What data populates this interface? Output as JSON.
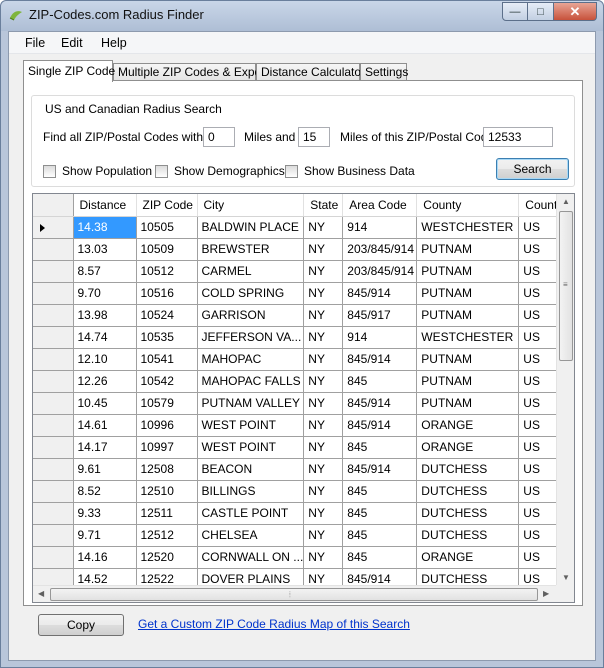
{
  "window": {
    "title": "ZIP-Codes.com Radius Finder",
    "icon": "zip-codes-logo",
    "controls": {
      "minimize": "—",
      "maximize": "□",
      "close": "✕"
    }
  },
  "menu": [
    "File",
    "Edit",
    "Help"
  ],
  "tabs": [
    {
      "label": "Single ZIP Code",
      "active": true
    },
    {
      "label": "Multiple ZIP Codes & Export",
      "active": false
    },
    {
      "label": "Distance Calculator",
      "active": false
    },
    {
      "label": "Settings",
      "active": false
    }
  ],
  "search": {
    "group_title": "US and Canadian Radius Search",
    "find_label": "Find all ZIP/Postal Codes within",
    "min_miles": "0",
    "miles_and_label": "Miles and",
    "max_miles": "15",
    "of_zip_label": "Miles of this ZIP/Postal Code",
    "zip": "12533",
    "show_population": "Show Population",
    "show_demographics": "Show Demographics",
    "show_business": "Show Business Data",
    "search_button": "Search"
  },
  "grid": {
    "columns": [
      "Distance",
      "ZIP Code",
      "City",
      "State",
      "Area Code",
      "County",
      "Country"
    ],
    "rows": [
      [
        "14.38",
        "10505",
        "BALDWIN PLACE",
        "NY",
        "914",
        "WESTCHESTER",
        "US"
      ],
      [
        "13.03",
        "10509",
        "BREWSTER",
        "NY",
        "203/845/914",
        "PUTNAM",
        "US"
      ],
      [
        "8.57",
        "10512",
        "CARMEL",
        "NY",
        "203/845/914",
        "PUTNAM",
        "US"
      ],
      [
        "9.70",
        "10516",
        "COLD SPRING",
        "NY",
        "845/914",
        "PUTNAM",
        "US"
      ],
      [
        "13.98",
        "10524",
        "GARRISON",
        "NY",
        "845/917",
        "PUTNAM",
        "US"
      ],
      [
        "14.74",
        "10535",
        "JEFFERSON VA...",
        "NY",
        "914",
        "WESTCHESTER",
        "US"
      ],
      [
        "12.10",
        "10541",
        "MAHOPAC",
        "NY",
        "845/914",
        "PUTNAM",
        "US"
      ],
      [
        "12.26",
        "10542",
        "MAHOPAC FALLS",
        "NY",
        "845",
        "PUTNAM",
        "US"
      ],
      [
        "10.45",
        "10579",
        "PUTNAM VALLEY",
        "NY",
        "845/914",
        "PUTNAM",
        "US"
      ],
      [
        "14.61",
        "10996",
        "WEST POINT",
        "NY",
        "845/914",
        "ORANGE",
        "US"
      ],
      [
        "14.17",
        "10997",
        "WEST POINT",
        "NY",
        "845",
        "ORANGE",
        "US"
      ],
      [
        "9.61",
        "12508",
        "BEACON",
        "NY",
        "845/914",
        "DUTCHESS",
        "US"
      ],
      [
        "8.52",
        "12510",
        "BILLINGS",
        "NY",
        "845",
        "DUTCHESS",
        "US"
      ],
      [
        "9.33",
        "12511",
        "CASTLE POINT",
        "NY",
        "845",
        "DUTCHESS",
        "US"
      ],
      [
        "9.71",
        "12512",
        "CHELSEA",
        "NY",
        "845",
        "DUTCHESS",
        "US"
      ],
      [
        "14.16",
        "12520",
        "CORNWALL ON ...",
        "NY",
        "845",
        "ORANGE",
        "US"
      ],
      [
        "14.52",
        "12522",
        "DOVER PLAINS",
        "NY",
        "845/914",
        "DUTCHESS",
        "US"
      ]
    ]
  },
  "footer": {
    "copy_button": "Copy",
    "map_link": "Get a Custom ZIP Code Radius Map of this Search"
  }
}
